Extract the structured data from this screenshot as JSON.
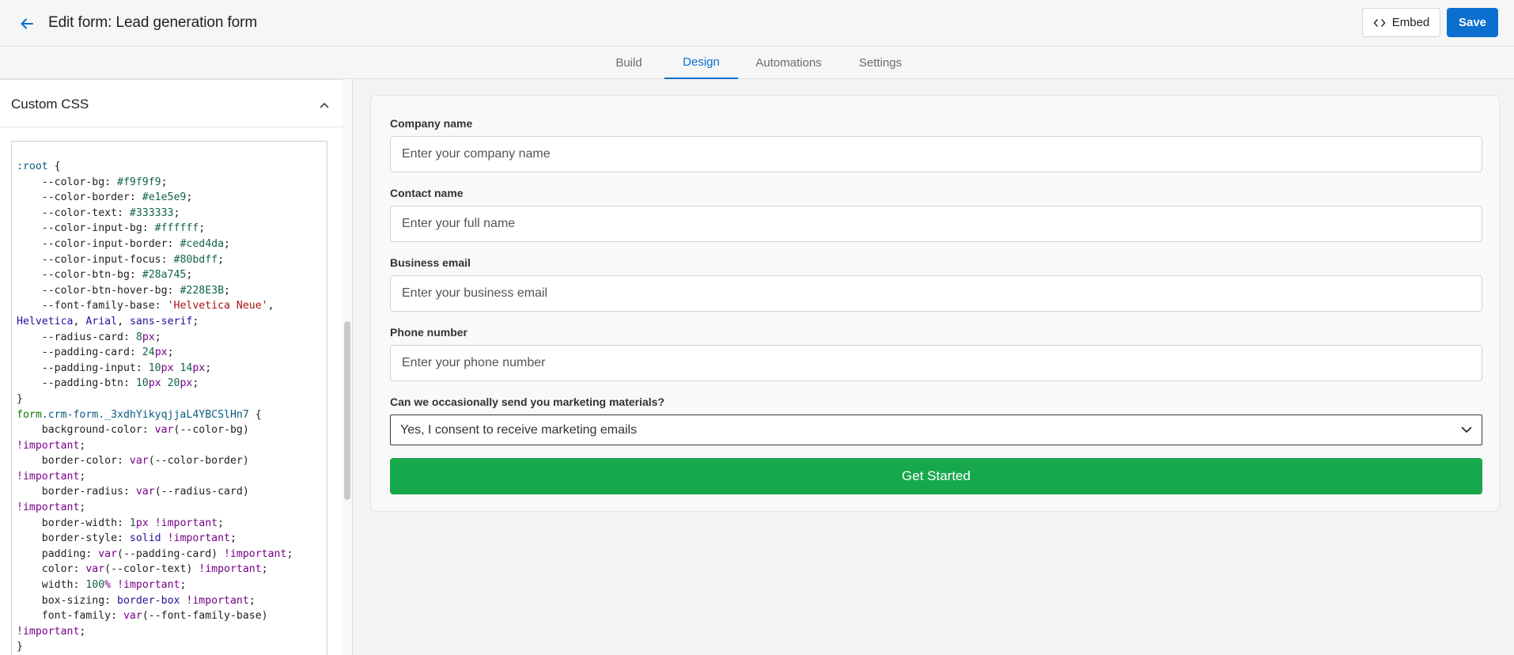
{
  "header": {
    "title": "Edit form: Lead generation form",
    "embed_label": "Embed",
    "save_label": "Save",
    "accent_color": "#0b6fd0"
  },
  "tabs": [
    {
      "label": "Build"
    },
    {
      "label": "Design"
    },
    {
      "label": "Automations"
    },
    {
      "label": "Settings"
    }
  ],
  "active_tab": "Design",
  "sidebar": {
    "section_title": "Custom CSS"
  },
  "css_code": [
    [
      {
        "t": ":root",
        "c": "kw-cls"
      },
      {
        "t": " {",
        "c": ""
      }
    ],
    [
      {
        "t": "    --color-bg: ",
        "c": ""
      },
      {
        "t": "#f9f9f9",
        "c": "kw-hex"
      },
      {
        "t": ";",
        "c": ""
      }
    ],
    [
      {
        "t": "    --color-border: ",
        "c": ""
      },
      {
        "t": "#e1e5e9",
        "c": "kw-hex"
      },
      {
        "t": ";",
        "c": ""
      }
    ],
    [
      {
        "t": "    --color-text: ",
        "c": ""
      },
      {
        "t": "#333333",
        "c": "kw-hex"
      },
      {
        "t": ";",
        "c": ""
      }
    ],
    [
      {
        "t": "    --color-input-bg: ",
        "c": ""
      },
      {
        "t": "#ffffff",
        "c": "kw-hex"
      },
      {
        "t": ";",
        "c": ""
      }
    ],
    [
      {
        "t": "    --color-input-border: ",
        "c": ""
      },
      {
        "t": "#ced4da",
        "c": "kw-hex"
      },
      {
        "t": ";",
        "c": ""
      }
    ],
    [
      {
        "t": "    --color-input-focus: ",
        "c": ""
      },
      {
        "t": "#80bdff",
        "c": "kw-hex"
      },
      {
        "t": ";",
        "c": ""
      }
    ],
    [
      {
        "t": "    --color-btn-bg: ",
        "c": ""
      },
      {
        "t": "#28a745",
        "c": "kw-hex"
      },
      {
        "t": ";",
        "c": ""
      }
    ],
    [
      {
        "t": "    --color-btn-hover-bg: ",
        "c": ""
      },
      {
        "t": "#228E3B",
        "c": "kw-hex"
      },
      {
        "t": ";",
        "c": ""
      }
    ],
    [
      {
        "t": "    --font-family-base: ",
        "c": ""
      },
      {
        "t": "'Helvetica Neue'",
        "c": "kw-str"
      },
      {
        "t": ",",
        "c": ""
      }
    ],
    [
      {
        "t": "Helvetica",
        "c": "kw-atom"
      },
      {
        "t": ", ",
        "c": ""
      },
      {
        "t": "Arial",
        "c": "kw-atom"
      },
      {
        "t": ", ",
        "c": ""
      },
      {
        "t": "sans-serif",
        "c": "kw-atom"
      },
      {
        "t": ";",
        "c": ""
      }
    ],
    [
      {
        "t": "    --radius-card: ",
        "c": ""
      },
      {
        "t": "8",
        "c": "kw-num"
      },
      {
        "t": "px",
        "c": "kw-imp"
      },
      {
        "t": ";",
        "c": ""
      }
    ],
    [
      {
        "t": "    --padding-card: ",
        "c": ""
      },
      {
        "t": "24",
        "c": "kw-num"
      },
      {
        "t": "px",
        "c": "kw-imp"
      },
      {
        "t": ";",
        "c": ""
      }
    ],
    [
      {
        "t": "    --padding-input: ",
        "c": ""
      },
      {
        "t": "10",
        "c": "kw-num"
      },
      {
        "t": "px",
        "c": "kw-imp"
      },
      {
        "t": " ",
        "c": ""
      },
      {
        "t": "14",
        "c": "kw-num"
      },
      {
        "t": "px",
        "c": "kw-imp"
      },
      {
        "t": ";",
        "c": ""
      }
    ],
    [
      {
        "t": "    --padding-btn: ",
        "c": ""
      },
      {
        "t": "10",
        "c": "kw-num"
      },
      {
        "t": "px",
        "c": "kw-imp"
      },
      {
        "t": " ",
        "c": ""
      },
      {
        "t": "20",
        "c": "kw-num"
      },
      {
        "t": "px",
        "c": "kw-imp"
      },
      {
        "t": ";",
        "c": ""
      }
    ],
    [
      {
        "t": "}",
        "c": ""
      }
    ],
    [
      {
        "t": "form",
        "c": "kw-sel"
      },
      {
        "t": ".crm-form._3xdhYikyqjjaL4YBCSlHn7",
        "c": "kw-cls"
      },
      {
        "t": " {",
        "c": ""
      }
    ],
    [
      {
        "t": "    background-color: ",
        "c": ""
      },
      {
        "t": "var",
        "c": "kw-imp"
      },
      {
        "t": "(--color-bg)",
        "c": ""
      }
    ],
    [
      {
        "t": "!important",
        "c": "kw-imp"
      },
      {
        "t": ";",
        "c": ""
      }
    ],
    [
      {
        "t": "    border-color: ",
        "c": ""
      },
      {
        "t": "var",
        "c": "kw-imp"
      },
      {
        "t": "(--color-border)",
        "c": ""
      }
    ],
    [
      {
        "t": "!important",
        "c": "kw-imp"
      },
      {
        "t": ";",
        "c": ""
      }
    ],
    [
      {
        "t": "    border-radius: ",
        "c": ""
      },
      {
        "t": "var",
        "c": "kw-imp"
      },
      {
        "t": "(--radius-card)",
        "c": ""
      }
    ],
    [
      {
        "t": "!important",
        "c": "kw-imp"
      },
      {
        "t": ";",
        "c": ""
      }
    ],
    [
      {
        "t": "    border-width: ",
        "c": ""
      },
      {
        "t": "1",
        "c": "kw-num"
      },
      {
        "t": "px",
        "c": "kw-imp"
      },
      {
        "t": " ",
        "c": ""
      },
      {
        "t": "!important",
        "c": "kw-imp"
      },
      {
        "t": ";",
        "c": ""
      }
    ],
    [
      {
        "t": "    border-style: ",
        "c": ""
      },
      {
        "t": "solid",
        "c": "kw-atom"
      },
      {
        "t": " ",
        "c": ""
      },
      {
        "t": "!important",
        "c": "kw-imp"
      },
      {
        "t": ";",
        "c": ""
      }
    ],
    [
      {
        "t": "    padding: ",
        "c": ""
      },
      {
        "t": "var",
        "c": "kw-imp"
      },
      {
        "t": "(--padding-card) ",
        "c": ""
      },
      {
        "t": "!important",
        "c": "kw-imp"
      },
      {
        "t": ";",
        "c": ""
      }
    ],
    [
      {
        "t": "    color: ",
        "c": ""
      },
      {
        "t": "var",
        "c": "kw-imp"
      },
      {
        "t": "(--color-text) ",
        "c": ""
      },
      {
        "t": "!important",
        "c": "kw-imp"
      },
      {
        "t": ";",
        "c": ""
      }
    ],
    [
      {
        "t": "    width: ",
        "c": ""
      },
      {
        "t": "100",
        "c": "kw-num"
      },
      {
        "t": "%",
        "c": "kw-imp"
      },
      {
        "t": " ",
        "c": ""
      },
      {
        "t": "!important",
        "c": "kw-imp"
      },
      {
        "t": ";",
        "c": ""
      }
    ],
    [
      {
        "t": "    box-sizing: ",
        "c": ""
      },
      {
        "t": "border-box",
        "c": "kw-atom"
      },
      {
        "t": " ",
        "c": ""
      },
      {
        "t": "!important",
        "c": "kw-imp"
      },
      {
        "t": ";",
        "c": ""
      }
    ],
    [
      {
        "t": "    font-family: ",
        "c": ""
      },
      {
        "t": "var",
        "c": "kw-imp"
      },
      {
        "t": "(--font-family-base)",
        "c": ""
      }
    ],
    [
      {
        "t": "!important",
        "c": "kw-imp"
      },
      {
        "t": ";",
        "c": ""
      }
    ],
    [
      {
        "t": "}",
        "c": ""
      }
    ]
  ],
  "form": {
    "fields": [
      {
        "label": "Company name",
        "placeholder": "Enter your company name"
      },
      {
        "label": "Contact name",
        "placeholder": "Enter your full name"
      },
      {
        "label": "Business email",
        "placeholder": "Enter your business email"
      },
      {
        "label": "Phone number",
        "placeholder": "Enter your phone number"
      }
    ],
    "consent": {
      "label": "Can we occasionally send you marketing materials?",
      "selected": "Yes, I consent to receive marketing emails"
    },
    "submit_label": "Get Started",
    "submit_color": "#17a84c"
  }
}
